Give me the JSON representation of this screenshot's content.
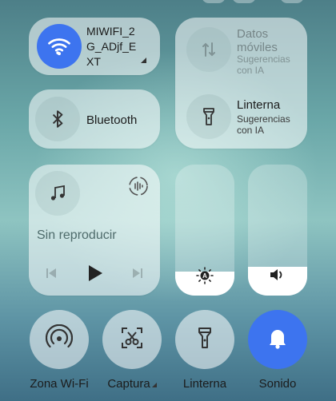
{
  "wifi_tile": {
    "ssid": "MIWIFI_2G_ADjf_EXT",
    "ssid_lines": [
      "MIWIFI_2",
      "G_ADjf_E",
      "XT"
    ],
    "icon": "wifi-icon",
    "accent": "#3d74ef"
  },
  "bluetooth_tile": {
    "label": "Bluetooth",
    "icon": "bluetooth-icon"
  },
  "mobile_data_tile": {
    "label_lines": [
      "Datos",
      "móviles"
    ],
    "sub_lines": [
      "Sugerencias",
      "con IA"
    ],
    "icon": "mobile-data-icon"
  },
  "flashlight_tile": {
    "label": "Linterna",
    "sub_lines": [
      "Sugerencias",
      "con IA"
    ],
    "icon": "flashlight-icon"
  },
  "media_tile": {
    "status": "Sin reproducir",
    "icons": [
      "music-note-icon",
      "audio-output-icon",
      "previous-icon",
      "play-icon",
      "next-icon"
    ]
  },
  "brightness_slider": {
    "level": 0.18,
    "icon": "brightness-auto-icon"
  },
  "volume_slider": {
    "level": 0.22,
    "icon": "volume-icon"
  },
  "bottom_buttons": [
    {
      "label": "Zona Wi-Fi",
      "icon": "hotspot-icon",
      "active": false
    },
    {
      "label": "Captura",
      "icon": "screenshot-icon",
      "active": false
    },
    {
      "label": "Linterna",
      "icon": "flashlight-icon",
      "active": false
    },
    {
      "label": "Sonido",
      "icon": "bell-icon",
      "active": true
    }
  ],
  "colors": {
    "accent": "#3d74ef",
    "tile_bg": "rgba(255,255,255,0.55)"
  }
}
